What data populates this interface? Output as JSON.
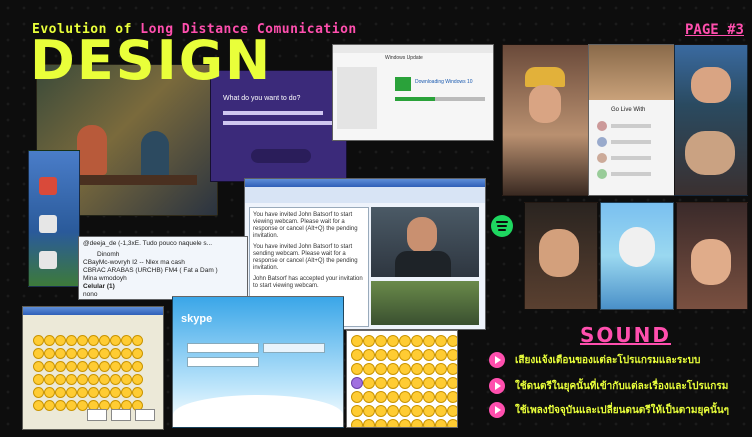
{
  "header": {
    "prefix": "Evolution of ",
    "highlight": "Long Distance Comunication",
    "page_tag": "PAGE #3"
  },
  "design_title": "DESIGN",
  "windows_dialog": {
    "prompt": "What do you want to do?"
  },
  "installer": {
    "title": "Windows Update",
    "status": "Downloading Windows 10"
  },
  "messenger": {
    "invite_1": "You have invited John Batsorf to start viewing webcam. Please wait for a response or cancel (Alt+Q) the pending invitation.",
    "invite_2": "You have invited John Batsorf to start sending webcam. Please wait for a response or cancel (Alt+Q) the pending invitation.",
    "accepted": "John Batsorf has accepted your invitation to start viewing webcam."
  },
  "contact_list": {
    "items": [
      "@deeja_de (-1,3xE. Tudo pouco naquele s...",
      "Dinomh",
      "CBayMc-wovryh I2 -- Nlex ma cash",
      "CBRAC ARABAS (URCHB) FM4 ( Fat a Dam )",
      "Mina wmodoyh",
      "Celular (1)",
      "nono"
    ]
  },
  "skype": {
    "logo": "skype"
  },
  "insta_live": {
    "title": "Go Live With"
  },
  "sound": {
    "title": "SOUND",
    "items": [
      "เสียงแจ้งเตือนของแต่ละโปรแกรมและระบบ",
      "ใช้ดนตรีในยุคนั้นที่เข้ากับแต่ละเรื่องและโปรแกรม",
      "ใช้เพลงปัจจุบันและเปลี่ยนดนตรีให้เป็นตามยุคนั้นๆ"
    ]
  },
  "colors": {
    "yellow": "#e9ff3a",
    "pink": "#ff4fae",
    "background": "#0d0d0d"
  }
}
